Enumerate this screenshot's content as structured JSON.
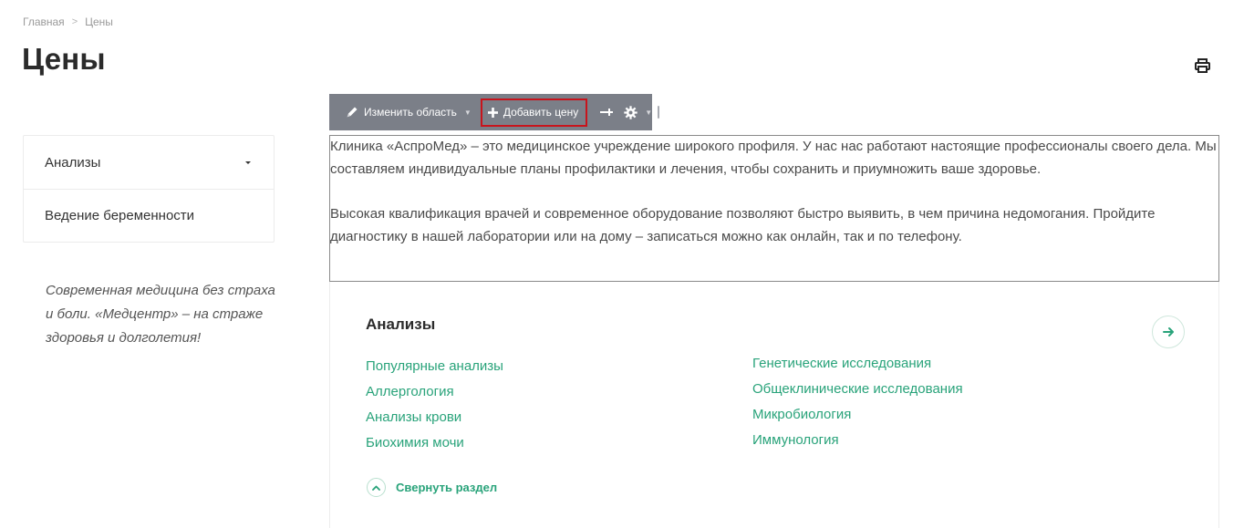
{
  "breadcrumb": {
    "home": "Главная",
    "current": "Цены"
  },
  "page": {
    "title": "Цены"
  },
  "sidebar": {
    "items": [
      {
        "label": "Анализы",
        "has_dropdown": true
      },
      {
        "label": "Ведение беременности",
        "has_dropdown": false
      }
    ],
    "slogan": "Современная медицина без страха и боли. «Медцентр» – на страже здоровья и долголетия!"
  },
  "toolbar": {
    "edit_area_label": "Изменить область",
    "add_price_label": "Добавить цену",
    "icons": [
      "pencil-icon",
      "plus-icon",
      "pin-icon",
      "gear-icon"
    ]
  },
  "editable_text": {
    "paragraph_1": "Клиника «АспроМед» – это медицинское учреждение широкого профиля. У нас нас работают настоящие профессионалы своего дела. Мы составляем индивидуальные планы профилактики и лечения, чтобы сохранить и приумножить ваше здоровье.",
    "paragraph_2": "Высокая квалификация врачей и современное оборудование позволяют быстро выявить, в чем причина недомогания. Пройдите диагностику в нашей лаборатории или на дому – записаться можно как онлайн, так и по телефону."
  },
  "price_section": {
    "title": "Анализы",
    "left_links": [
      "Популярные анализы",
      "Аллергология",
      "Анализы крови",
      "Биохимия мочи"
    ],
    "right_links": [
      "Генетические исследования",
      "Общеклинические исследования",
      "Микробиология",
      "Иммунология"
    ],
    "collapse_label": "Свернуть раздел"
  },
  "colors": {
    "accent_green": "#29a37a",
    "toolbar_bg": "#7b7f88",
    "highlight_red": "#c8141c"
  }
}
